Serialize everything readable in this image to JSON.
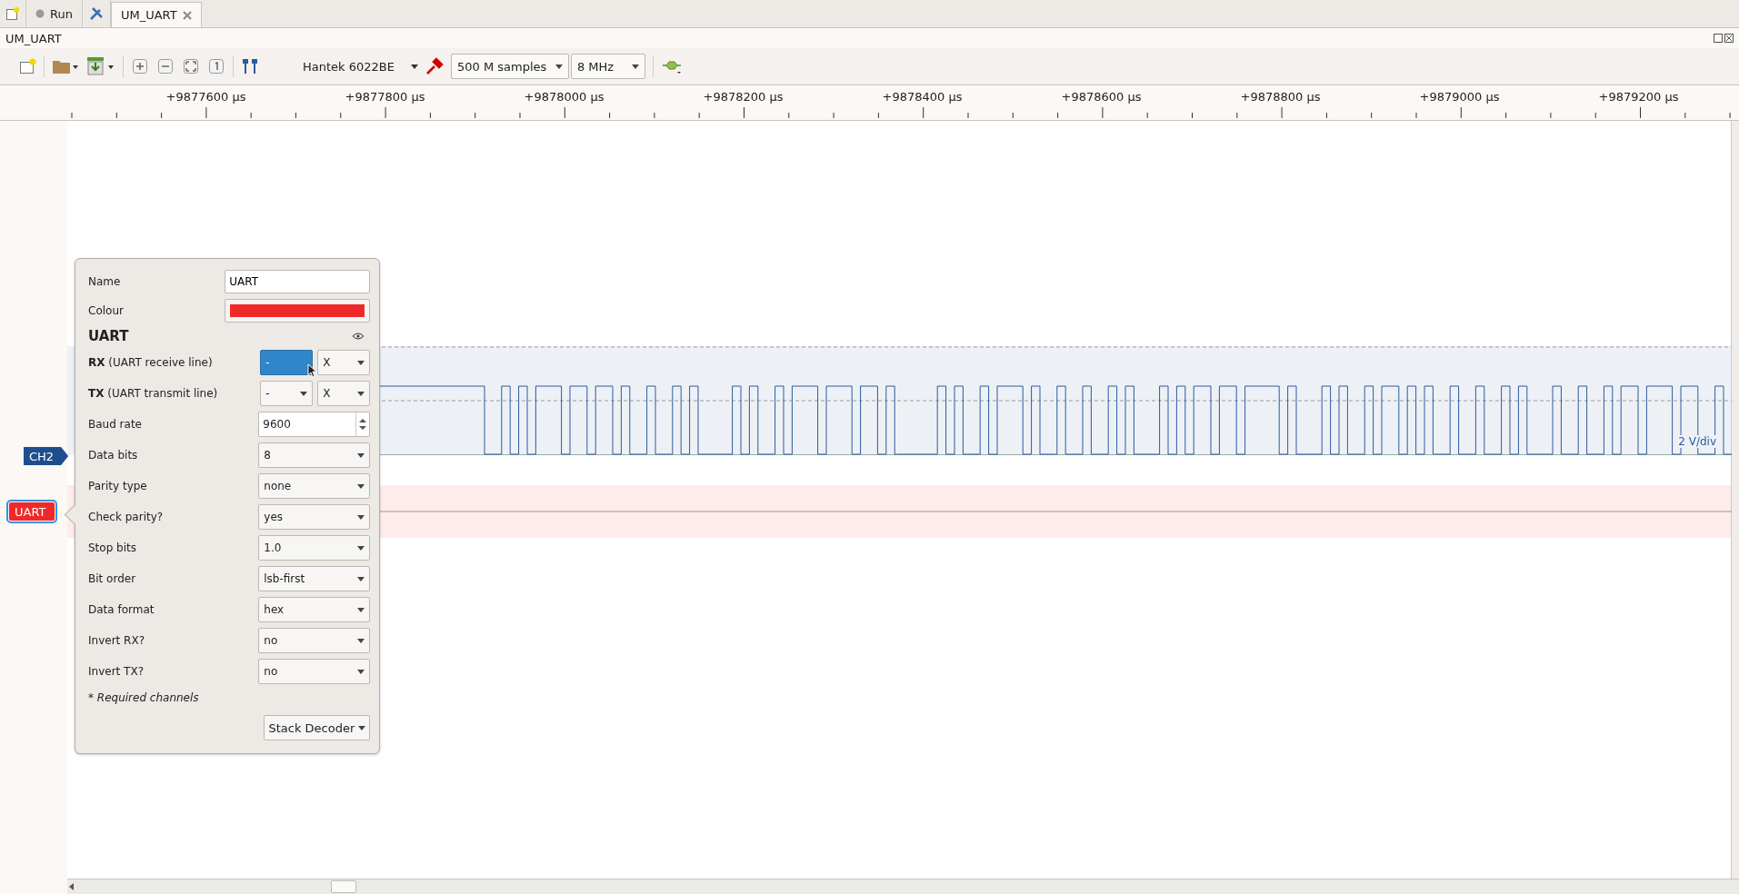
{
  "tab_bar": {
    "tabs": [
      {
        "label": "Run",
        "selected": false,
        "closable": false
      },
      {
        "label": "UM_UART",
        "selected": true,
        "closable": true
      }
    ]
  },
  "window": {
    "title": "UM_UART"
  },
  "toolbar": {
    "device": "Hantek 6022BE",
    "samples": "500 M samples",
    "samplerate": "8 MHz"
  },
  "ruler": {
    "labels": [
      "+9877600 µs",
      "+9877800 µs",
      "+9878000 µs",
      "+9878200 µs",
      "+9878400 µs",
      "+9878600 µs",
      "+9878800 µs",
      "+9879000 µs",
      "+9879200 µs"
    ]
  },
  "traces": [
    {
      "label": "CH2",
      "kind": "analog",
      "color": "#1f4e8f",
      "selected": false,
      "scale": "2 V/div"
    },
    {
      "label": "UART",
      "kind": "decoder",
      "color": "#ef2929",
      "selected": true
    }
  ],
  "popup": {
    "name": {
      "label": "Name",
      "value": "UART"
    },
    "colour": {
      "label": "Colour",
      "color": "#ef2929"
    },
    "decoder": "UART",
    "channels": [
      {
        "name": "RX",
        "description": "(UART receive line)",
        "channel": "-",
        "trigger": "X",
        "focused": true
      },
      {
        "name": "TX",
        "description": "(UART transmit line)",
        "channel": "-",
        "trigger": "X",
        "focused": false
      }
    ],
    "options": [
      {
        "label": "Baud rate",
        "value": "9600",
        "kind": "spin"
      },
      {
        "label": "Data bits",
        "value": "8",
        "kind": "select"
      },
      {
        "label": "Parity type",
        "value": "none",
        "kind": "select"
      },
      {
        "label": "Check parity?",
        "value": "yes",
        "kind": "select"
      },
      {
        "label": "Stop bits",
        "value": "1.0",
        "kind": "select"
      },
      {
        "label": "Bit order",
        "value": "lsb-first",
        "kind": "select"
      },
      {
        "label": "Data format",
        "value": "hex",
        "kind": "select"
      },
      {
        "label": "Invert RX?",
        "value": "no",
        "kind": "select"
      },
      {
        "label": "Invert TX?",
        "value": "no",
        "kind": "select"
      }
    ],
    "note": "* Required channels",
    "stack_button": "Stack Decoder"
  }
}
